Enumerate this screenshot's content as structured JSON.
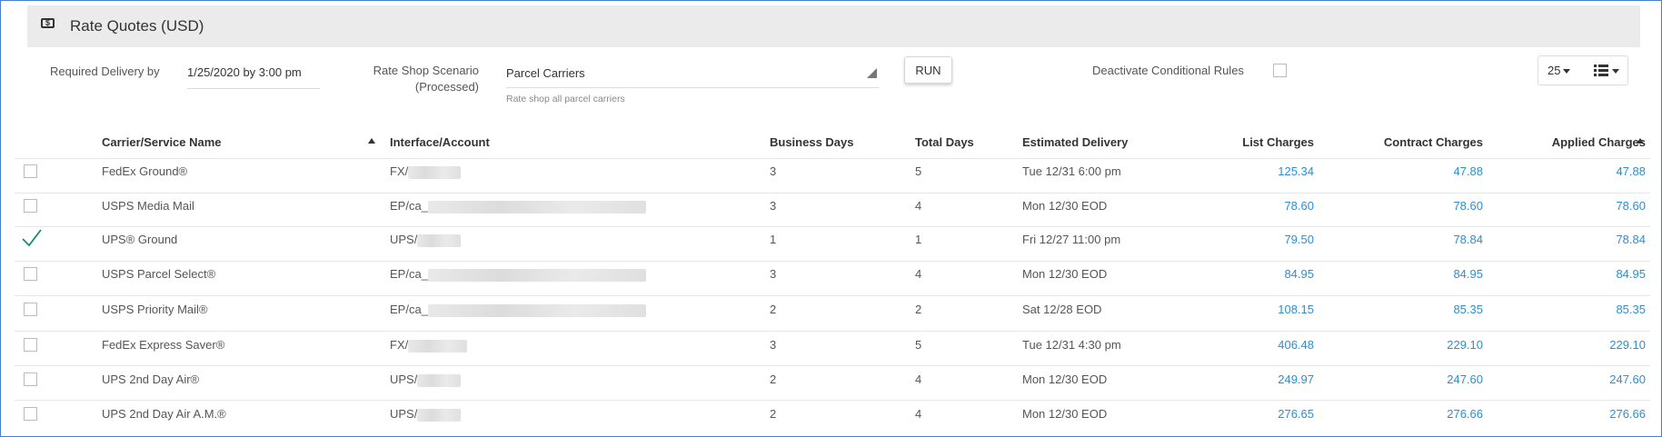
{
  "panel": {
    "title": "Rate Quotes (USD)",
    "icon": "money-icon"
  },
  "controls": {
    "delivery_label": "Required Delivery by",
    "delivery_value": "1/25/2020 by 3:00 pm",
    "scenario_label_1": "Rate Shop Scenario",
    "scenario_label_2": "(Processed)",
    "scenario_value": "Parcel Carriers",
    "scenario_hint": "Rate shop all parcel carriers",
    "run_label": "RUN",
    "deactivate_label": "Deactivate Conditional Rules",
    "page_size": "25"
  },
  "columns": {
    "carrier": "Carrier/Service Name",
    "interface": "Interface/Account",
    "business_days": "Business Days",
    "total_days": "Total Days",
    "estimated": "Estimated Delivery",
    "list": "List Charges",
    "contract": "Contract Charges",
    "applied": "Applied Charges"
  },
  "rows": [
    {
      "selected": false,
      "carrier": "FedEx Ground®",
      "interface": "FX/",
      "business_days": "3",
      "total_days": "5",
      "estimated": "Tue 12/31 6:00 pm",
      "list": "125.34",
      "contract": "47.88",
      "applied": "47.88"
    },
    {
      "selected": false,
      "carrier": "USPS Media Mail",
      "interface": "EP/ca_",
      "business_days": "3",
      "total_days": "4",
      "estimated": "Mon 12/30 EOD",
      "list": "78.60",
      "contract": "78.60",
      "applied": "78.60"
    },
    {
      "selected": true,
      "carrier": "UPS® Ground",
      "interface": "UPS/",
      "business_days": "1",
      "total_days": "1",
      "estimated": "Fri 12/27 11:00 pm",
      "list": "79.50",
      "contract": "78.84",
      "applied": "78.84"
    },
    {
      "selected": false,
      "carrier": "USPS Parcel Select®",
      "interface": "EP/ca_",
      "business_days": "3",
      "total_days": "4",
      "estimated": "Mon 12/30 EOD",
      "list": "84.95",
      "contract": "84.95",
      "applied": "84.95"
    },
    {
      "selected": false,
      "carrier": "USPS Priority Mail®",
      "interface": "EP/ca_",
      "business_days": "2",
      "total_days": "2",
      "estimated": "Sat 12/28 EOD",
      "list": "108.15",
      "contract": "85.35",
      "applied": "85.35"
    },
    {
      "selected": false,
      "carrier": "FedEx Express Saver®",
      "interface": "FX/",
      "business_days": "3",
      "total_days": "5",
      "estimated": "Tue 12/31 4:30 pm",
      "list": "406.48",
      "contract": "229.10",
      "applied": "229.10"
    },
    {
      "selected": false,
      "carrier": "UPS 2nd Day Air®",
      "interface": "UPS/",
      "business_days": "2",
      "total_days": "4",
      "estimated": "Mon 12/30 EOD",
      "list": "249.97",
      "contract": "247.60",
      "applied": "247.60"
    },
    {
      "selected": false,
      "carrier": "UPS 2nd Day Air A.M.®",
      "interface": "UPS/",
      "business_days": "2",
      "total_days": "4",
      "estimated": "Mon 12/30 EOD",
      "list": "276.65",
      "contract": "276.66",
      "applied": "276.66"
    }
  ],
  "colors": {
    "link": "#2b8fd6",
    "check": "#1a8a7a",
    "header_bg": "#ebebeb",
    "frame": "#4a7fd0"
  }
}
